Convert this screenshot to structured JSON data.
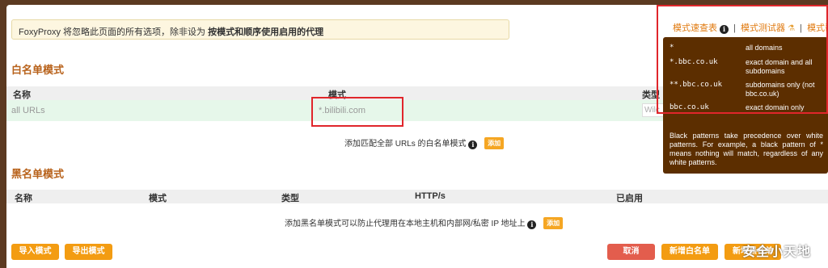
{
  "notice": {
    "text_prefix": "FoxyProxy 将忽略此页面的所有选项，除非设为 ",
    "text_bold": "按模式和顺序使用启用的代理"
  },
  "help_links": {
    "cheatsheet": "模式速查表",
    "tester": "模式测试器",
    "help": "模式帮助"
  },
  "whitelist": {
    "title": "白名单模式",
    "columns": [
      "名称",
      "模式",
      "类型"
    ],
    "row": {
      "name": "all URLs",
      "pattern": "*.bilibili.com",
      "type": "Wilc"
    },
    "add_text": "添加匹配全部 URLs 的白名单模式",
    "add_button": "添加"
  },
  "blacklist": {
    "title": "黑名单模式",
    "columns": [
      "名称",
      "模式",
      "类型",
      "HTTP/s",
      "已启用"
    ],
    "add_text": "添加黑名单模式可以防止代理用在本地主机和内部网/私密 IP 地址上",
    "add_button": "添加"
  },
  "tooltip": {
    "rows": [
      {
        "pattern": "*",
        "desc": "all domains"
      },
      {
        "pattern": "*.bbc.co.uk",
        "desc": "exact domain and all subdomains"
      },
      {
        "pattern": "**.bbc.co.uk",
        "desc": "subdomains only (not bbc.co.uk)"
      },
      {
        "pattern": "bbc.co.uk",
        "desc": "exact domain only"
      }
    ],
    "note": "Black patterns take precedence over white patterns. For example, a black pattern of * means nothing will match, regardless of any white patterns."
  },
  "footer": {
    "import": "导入模式",
    "export": "导出模式",
    "cancel": "取消",
    "new_whitelist": "新增白名单",
    "new_blacklist": "新增黑名单"
  },
  "watermark": "安全小天地",
  "colors": {
    "accent": "#f39c12",
    "title": "#b8621b",
    "danger": "#e35d4d",
    "tooltip_bg": "#5c2e00",
    "highlight_box": "#e0262b"
  }
}
